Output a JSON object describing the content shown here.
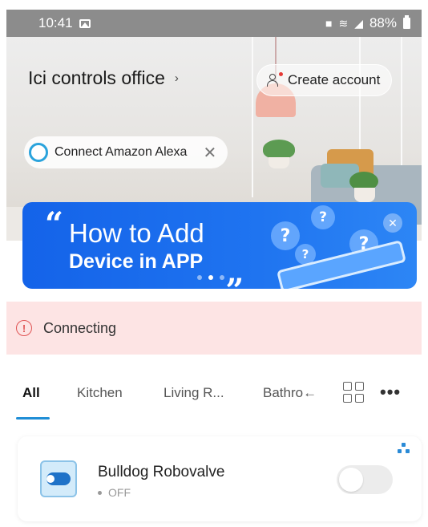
{
  "status_bar": {
    "time": "10:41",
    "battery": "88%",
    "icons": [
      "image-icon",
      "lock-icon",
      "wifi-icon",
      "signal-icon",
      "battery-icon"
    ]
  },
  "header": {
    "home_name": "Ici controls office",
    "chevron": "›",
    "create_account_label": "Create account"
  },
  "alexa_chip": {
    "label": "Connect Amazon Alexa",
    "close": "✕"
  },
  "banner": {
    "line1": "How to Add",
    "line2": "Device in APP",
    "quote_open": "“",
    "quote_close": "„",
    "close": "✕",
    "bubble_glyph": "?",
    "accent": "#1463e9"
  },
  "alert": {
    "text": "Connecting",
    "icon": "!",
    "background": "#fde4e4"
  },
  "tabs": {
    "items": [
      "All",
      "Kitchen",
      "Living R...",
      "Bathro←"
    ],
    "active_index": 0,
    "more": "•••"
  },
  "device": {
    "name": "Bulldog Robovalve",
    "status": "OFF",
    "on": false
  }
}
